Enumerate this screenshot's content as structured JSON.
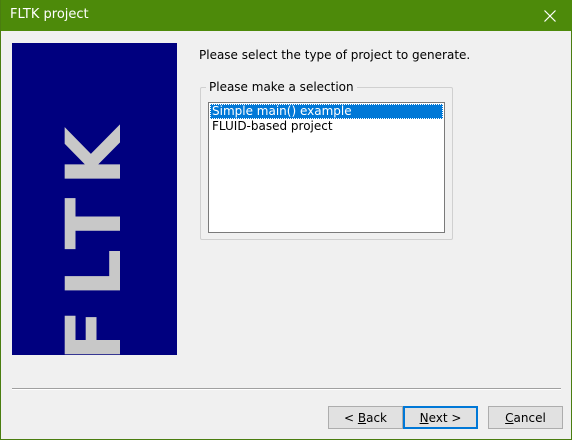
{
  "window": {
    "title": "FLTK project",
    "close_icon": "close-icon"
  },
  "banner": {
    "text": "FLTK",
    "background": "#00007f",
    "text_color": "#c8c8c8"
  },
  "main": {
    "prompt": "Please select the type of project to generate.",
    "group_label": "Please make a selection",
    "options": [
      {
        "label": "Simple main() example",
        "selected": true
      },
      {
        "label": "FLUID-based project",
        "selected": false
      }
    ]
  },
  "buttons": {
    "back": {
      "prefix": "< ",
      "accel": "B",
      "rest": "ack"
    },
    "next": {
      "accel": "N",
      "rest": "ext >"
    },
    "cancel": {
      "accel": "C",
      "rest": "ancel"
    }
  },
  "colors": {
    "titlebar": "#4d8a0a",
    "selection": "#0078d7"
  }
}
